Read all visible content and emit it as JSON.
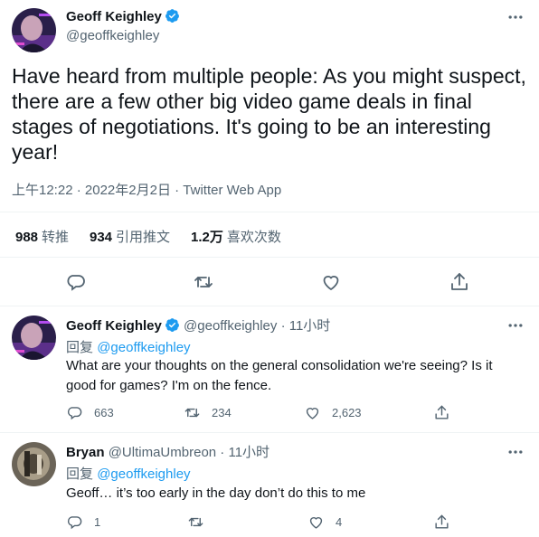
{
  "author": {
    "name": "Geoff Keighley",
    "handle": "@geoffkeighley"
  },
  "tweet": {
    "text": "Have heard from multiple people: As you might suspect, there are a few other big video game deals in final stages of negotiations. It's going to be an interesting year!",
    "time": "上午12:22",
    "separator": "·",
    "date": "2022年2月2日",
    "source": "Twitter Web App"
  },
  "stats": {
    "retweets_count": "988",
    "retweets_label": "转推",
    "quotes_count": "934",
    "quotes_label": "引用推文",
    "likes_count": "1.2万",
    "likes_label": "喜欢次数"
  },
  "replies": [
    {
      "name": "Geoff Keighley",
      "handle": "@geoffkeighley",
      "separator": "·",
      "time": "11小时",
      "replying_prefix": "回复",
      "replying_to": "@geoffkeighley",
      "text": "What are your thoughts on the general consolidation we're seeing? Is it good for games? I'm on the fence.",
      "reply_count": "663",
      "retweet_count": "234",
      "like_count": "2,623",
      "verified": true
    },
    {
      "name": "Bryan",
      "handle": "@UltimaUmbreon",
      "separator": "·",
      "time": "11小时",
      "replying_prefix": "回复",
      "replying_to": "@geoffkeighley",
      "text": "Geoff… it’s too early in the day don’t do this to me",
      "reply_count": "1",
      "retweet_count": "",
      "like_count": "4",
      "verified": false
    }
  ],
  "colors": {
    "accent": "#1d9bf0",
    "secondary_text": "#536471",
    "primary_text": "#0f1419",
    "divider": "#eff3f4"
  },
  "icons": {
    "verified": "verified-badge-icon",
    "more": "more-dots-icon",
    "reply": "reply-bubble-icon",
    "retweet": "retweet-arrows-icon",
    "like": "heart-icon",
    "share": "share-upload-icon"
  }
}
